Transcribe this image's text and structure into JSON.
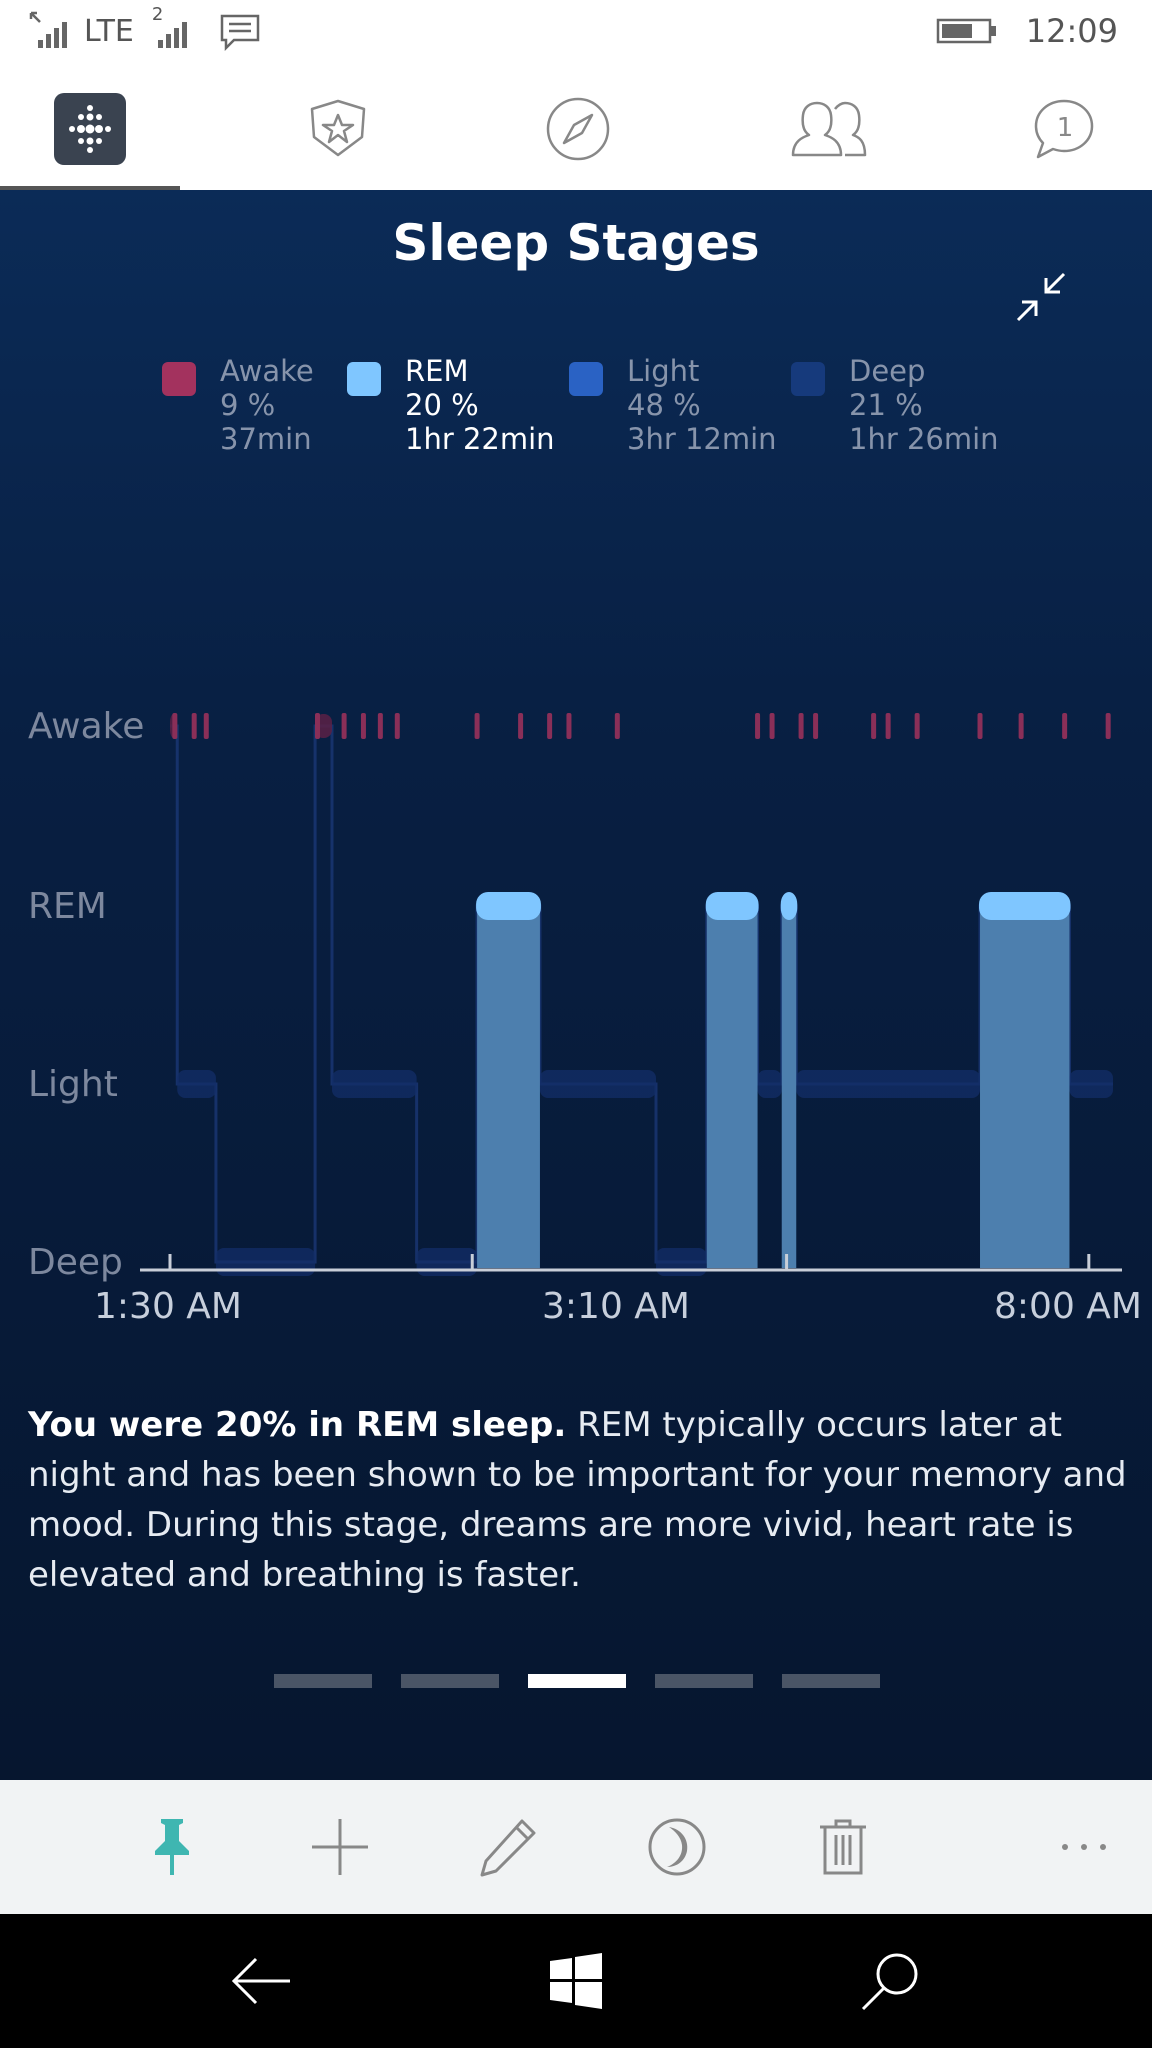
{
  "status_bar": {
    "network_label": "LTE",
    "sim_label": "2",
    "time": "12:09",
    "icons": [
      "signal-icon",
      "signal-2-icon",
      "message-icon",
      "battery-icon"
    ]
  },
  "tabs": [
    {
      "name": "dashboard",
      "icon": "fitbit-dots-icon",
      "active": true
    },
    {
      "name": "challenges",
      "icon": "star-badge-icon",
      "active": false
    },
    {
      "name": "discover",
      "icon": "compass-icon",
      "active": false
    },
    {
      "name": "friends",
      "icon": "friends-icon",
      "active": false
    },
    {
      "name": "messages",
      "icon": "chat-bubble-icon",
      "badge": "1",
      "active": false
    }
  ],
  "panel": {
    "title": "Sleep Stages",
    "collapse_icon": "collapse-arrows-icon"
  },
  "legend": [
    {
      "label": "Awake",
      "percent": "9 %",
      "duration": "37min",
      "color": "#a3325e",
      "active": false
    },
    {
      "label": "REM",
      "percent": "20 %",
      "duration": "1hr 22min",
      "color": "#7fc6ff",
      "active": true
    },
    {
      "label": "Light",
      "percent": "48 %",
      "duration": "3hr 12min",
      "color": "#2a62c4",
      "active": false
    },
    {
      "label": "Deep",
      "percent": "21 %",
      "duration": "1hr 26min",
      "color": "#163a7c",
      "active": false
    }
  ],
  "chart_data": {
    "type": "area",
    "y_stages": [
      "Awake",
      "REM",
      "Light",
      "Deep"
    ],
    "x_tick_labels": [
      "1:30 AM",
      "3:10 AM",
      "8:00 AM"
    ],
    "x_range_minutes": [
      0,
      390
    ],
    "highlighted_stage": "REM",
    "segments": [
      {
        "stage": "Awake",
        "start": 0,
        "end": 3
      },
      {
        "stage": "Light",
        "start": 3,
        "end": 19
      },
      {
        "stage": "Deep",
        "start": 19,
        "end": 60
      },
      {
        "stage": "Awake",
        "start": 60,
        "end": 67
      },
      {
        "stage": "Light",
        "start": 67,
        "end": 102
      },
      {
        "stage": "Deep",
        "start": 102,
        "end": 127
      },
      {
        "stage": "REM",
        "start": 127,
        "end": 153
      },
      {
        "stage": "Light",
        "start": 153,
        "end": 201
      },
      {
        "stage": "Deep",
        "start": 201,
        "end": 222
      },
      {
        "stage": "REM",
        "start": 222,
        "end": 243
      },
      {
        "stage": "Light",
        "start": 243,
        "end": 253
      },
      {
        "stage": "REM",
        "start": 253,
        "end": 259
      },
      {
        "stage": "Light",
        "start": 259,
        "end": 335
      },
      {
        "stage": "REM",
        "start": 335,
        "end": 372
      },
      {
        "stage": "Light",
        "start": 372,
        "end": 390
      }
    ],
    "awake_ticks": [
      2,
      10,
      15,
      61,
      72,
      80,
      87,
      94,
      127,
      145,
      157,
      165,
      185,
      243,
      249,
      261,
      267,
      291,
      297,
      309,
      335,
      352,
      370,
      388
    ]
  },
  "description": {
    "bold": "You were 20% in REM sleep.",
    "text": " REM typically occurs later at night and has been shown to be important for your memory and mood. During this stage, dreams are more vivid, heart rate is elevated and breathing is faster."
  },
  "pager": {
    "count": 5,
    "active_index": 2
  },
  "app_bar": {
    "buttons": [
      {
        "name": "pin",
        "icon": "pin-icon",
        "color": "#3fb6b1"
      },
      {
        "name": "add",
        "icon": "plus-icon"
      },
      {
        "name": "edit",
        "icon": "pencil-icon"
      },
      {
        "name": "sleep",
        "icon": "moon-icon"
      },
      {
        "name": "delete",
        "icon": "trash-icon"
      },
      {
        "name": "more",
        "icon": "more-icon"
      }
    ]
  },
  "nav_bar": {
    "buttons": [
      {
        "name": "back",
        "icon": "back-arrow-icon"
      },
      {
        "name": "start",
        "icon": "windows-logo-icon"
      },
      {
        "name": "search",
        "icon": "search-icon"
      }
    ]
  }
}
